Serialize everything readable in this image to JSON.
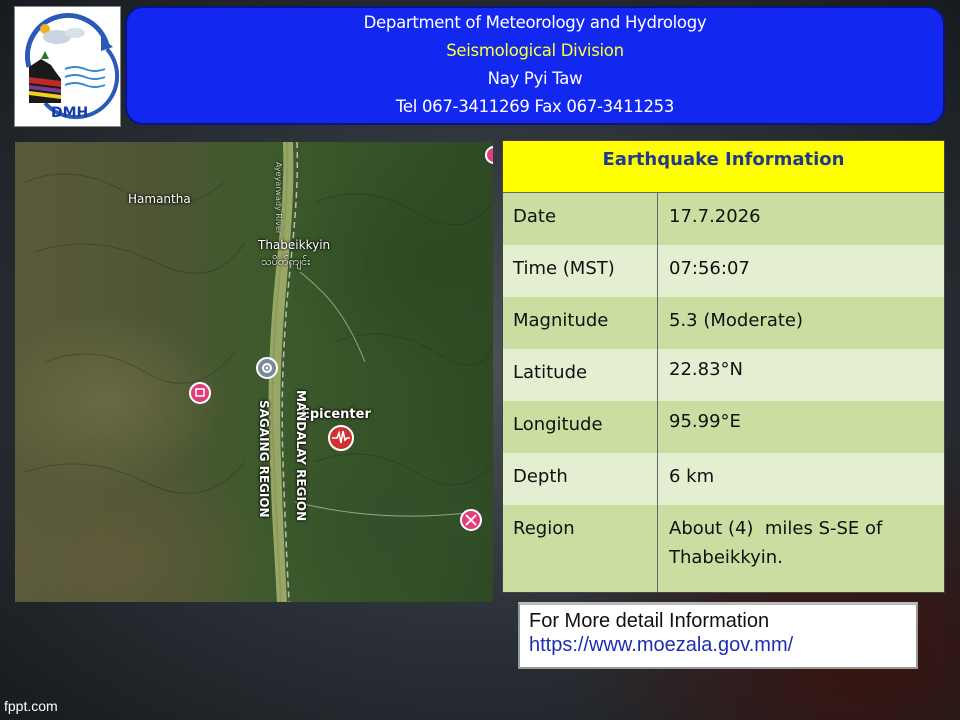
{
  "header": {
    "line1": "Department of Meteorology and Hydrology",
    "line2": "Seismological Division",
    "line3": "Nay Pyi Taw",
    "line4": "Tel 067-3411269 Fax 067-3411253",
    "logo_text": "DMH",
    "color_bg": "#1228f0",
    "color_highlight": "#ffff33"
  },
  "map": {
    "places": {
      "hamantha": "Hamantha",
      "thabeikkyin": "Thabeikkyin",
      "thabeikkyin_local": "သပိတ်ကျင်း",
      "epicenter": "Epicenter"
    },
    "regions": {
      "sagaing": "SAGAING REGION",
      "mandalay": "MANDALAY REGION"
    },
    "river": "Ayeyarwady River"
  },
  "info": {
    "title": "Earthquake Information",
    "rows": [
      {
        "label": "Date",
        "value": "17.7.2026"
      },
      {
        "label": "Time (MST)",
        "value": "07:56:07"
      },
      {
        "label": "Magnitude",
        "value": "5.3 (Moderate)"
      },
      {
        "label": "Latitude",
        "value": "22.83°N"
      },
      {
        "label": "Longitude",
        "value": "95.99°E"
      },
      {
        "label": "Depth",
        "value": "6 km"
      },
      {
        "label": "Region",
        "value": "About (4)  miles S-SE of Thabeikkyin."
      }
    ]
  },
  "detail": {
    "text": "For More detail Information",
    "url": "https://www.moezala.gov.mm/"
  },
  "footer": {
    "text": "fppt.com"
  }
}
